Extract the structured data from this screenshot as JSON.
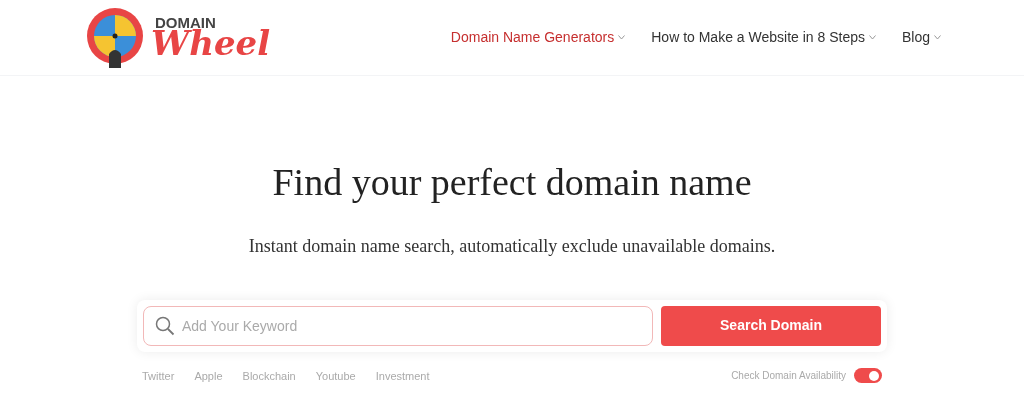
{
  "logo": {
    "line1": "DOMAIN",
    "line2": "Wheel"
  },
  "nav": [
    {
      "label": "Domain Name Generators",
      "selected": true
    },
    {
      "label": "How to Make a Website in 8 Steps",
      "selected": false
    },
    {
      "label": "Blog",
      "selected": false
    }
  ],
  "hero": {
    "title": "Find your perfect domain name",
    "subtitle": "Instant domain name search, automatically exclude unavailable domains."
  },
  "search": {
    "placeholder": "Add Your Keyword",
    "button": "Search Domain"
  },
  "suggestions": [
    "Twitter",
    "Apple",
    "Blockchain",
    "Youtube",
    "Investment"
  ],
  "availability_toggle": {
    "label": "Check Domain Availability",
    "on": true
  }
}
